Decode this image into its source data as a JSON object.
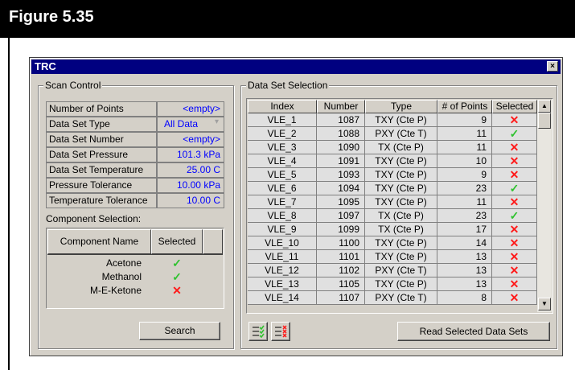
{
  "figure_title": "Figure 5.35",
  "window": {
    "title": "TRC",
    "close_glyph": "×"
  },
  "scan_control": {
    "label": "Scan Control",
    "params": [
      {
        "name": "Number of Points",
        "value": "<empty>"
      },
      {
        "name": "Data Set Type",
        "value": "All Data"
      },
      {
        "name": "Data Set Number",
        "value": "<empty>"
      },
      {
        "name": "Data Set Pressure",
        "value": "101.3 kPa"
      },
      {
        "name": "Data Set Temperature",
        "value": "25.00 C"
      },
      {
        "name": "Pressure  Tolerance",
        "value": "10.00 kPa"
      },
      {
        "name": "Temperature Tolerance",
        "value": "10.00 C"
      }
    ],
    "component_selection_label": "Component Selection:",
    "component_headers": [
      "Component Name",
      "Selected"
    ],
    "components": [
      {
        "name": "Acetone",
        "selected": "✓"
      },
      {
        "name": "Methanol",
        "selected": "✓"
      },
      {
        "name": "M-E-Ketone",
        "selected": "✕"
      }
    ],
    "search_label": "Search"
  },
  "data_set_selection": {
    "label": "Data Set Selection",
    "headers": [
      "Index",
      "Number",
      "Type",
      "# of Points",
      "Selected"
    ],
    "rows": [
      [
        "VLE_1",
        "1087",
        "TXY (Cte P)",
        "9",
        "✕"
      ],
      [
        "VLE_2",
        "1088",
        "PXY (Cte T)",
        "11",
        "✓"
      ],
      [
        "VLE_3",
        "1090",
        "TX (Cte P)",
        "11",
        "✕"
      ],
      [
        "VLE_4",
        "1091",
        "TXY (Cte P)",
        "10",
        "✕"
      ],
      [
        "VLE_5",
        "1093",
        "TXY (Cte P)",
        "9",
        "✕"
      ],
      [
        "VLE_6",
        "1094",
        "TXY (Cte P)",
        "23",
        "✓"
      ],
      [
        "VLE_7",
        "1095",
        "TXY (Cte P)",
        "11",
        "✕"
      ],
      [
        "VLE_8",
        "1097",
        "TX (Cte P)",
        "23",
        "✓"
      ],
      [
        "VLE_9",
        "1099",
        "TX (Cte P)",
        "17",
        "✕"
      ],
      [
        "VLE_10",
        "1100",
        "TXY (Cte P)",
        "14",
        "✕"
      ],
      [
        "VLE_11",
        "1101",
        "TXY (Cte P)",
        "13",
        "✕"
      ],
      [
        "VLE_12",
        "1102",
        "PXY (Cte T)",
        "13",
        "✕"
      ],
      [
        "VLE_13",
        "1105",
        "TXY (Cte P)",
        "13",
        "✕"
      ],
      [
        "VLE_14",
        "1107",
        "PXY (Cte T)",
        "8",
        "✕"
      ]
    ],
    "read_button_label": "Read Selected Data Sets"
  },
  "colors": {
    "ok": "#2fc22f",
    "x": "#ff1a1a",
    "value_blue": "#0000ff",
    "title_bar": "#000080"
  }
}
